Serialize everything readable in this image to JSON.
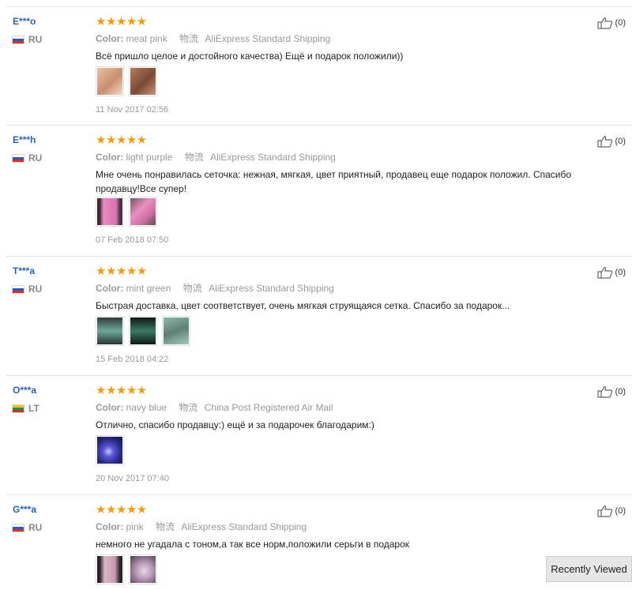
{
  "reviews": [
    {
      "user": "E***o",
      "country": "RU",
      "stars": "★★★★★",
      "color_label": "Color:",
      "color_value": "meat pink",
      "shipping_label": "物流",
      "shipping": "AliExpress Standard Shipping",
      "text": "Всё пришло целое и достойного качества) Ещё и подарок положили))",
      "date": "11 Nov 2017 02:56",
      "helpful_count": "(0)",
      "photos": [
        "meat-pink-photo",
        "meat-pink-photo"
      ]
    },
    {
      "user": "E***h",
      "country": "RU",
      "stars": "★★★★★",
      "color_label": "Color:",
      "color_value": "light purple",
      "shipping_label": "物流",
      "shipping": "AliExpress Standard Shipping",
      "text": "Мне очень понравилась сеточка: нежная, мягкая, цвет приятный, продавец еще подарок положил. Спасибо продавцу!Все супер!",
      "date": "07 Feb 2018 07:50",
      "helpful_count": "(0)",
      "photos": [
        "light-purple-photo",
        "light-purple-photo"
      ]
    },
    {
      "user": "T***a",
      "country": "RU",
      "stars": "★★★★★",
      "color_label": "Color:",
      "color_value": "mint green",
      "shipping_label": "物流",
      "shipping": "AliExpress Standard Shipping",
      "text": "Быстрая доставка, цвет соответствует, очень мягкая струящаяся сетка. Спасибо за подарок...",
      "date": "15 Feb 2018 04:22",
      "helpful_count": "(0)",
      "photos": [
        "mint-green-photo",
        "mint-green-photo",
        "mint-green-photo"
      ]
    },
    {
      "user": "O***a",
      "country": "LT",
      "stars": "★★★★★",
      "color_label": "Color:",
      "color_value": "navy blue",
      "shipping_label": "物流",
      "shipping": "China Post Registered Air Mail",
      "text": "Отлично, спасибо продавцу:) ещё и за подарочек благодарим:)",
      "date": "20 Nov 2017 07:40",
      "helpful_count": "(0)",
      "photos": [
        "navy-blue-photo"
      ]
    },
    {
      "user": "G***a",
      "country": "RU",
      "stars": "★★★★★",
      "color_label": "Color:",
      "color_value": "pink",
      "shipping_label": "物流",
      "shipping": "AliExpress Standard Shipping",
      "text": "немного не угадала с тоном,а так все норм,положили серьги в подарок",
      "date": "",
      "helpful_count": "(0)",
      "photos": [
        "pink-photo",
        "pink-photo"
      ]
    }
  ],
  "recently_viewed_label": "Recently Viewed",
  "colors": {
    "user_name": "#2a62b8",
    "star": "#f39c12",
    "meta_text": "#999999",
    "divider": "#e8e8e8"
  }
}
